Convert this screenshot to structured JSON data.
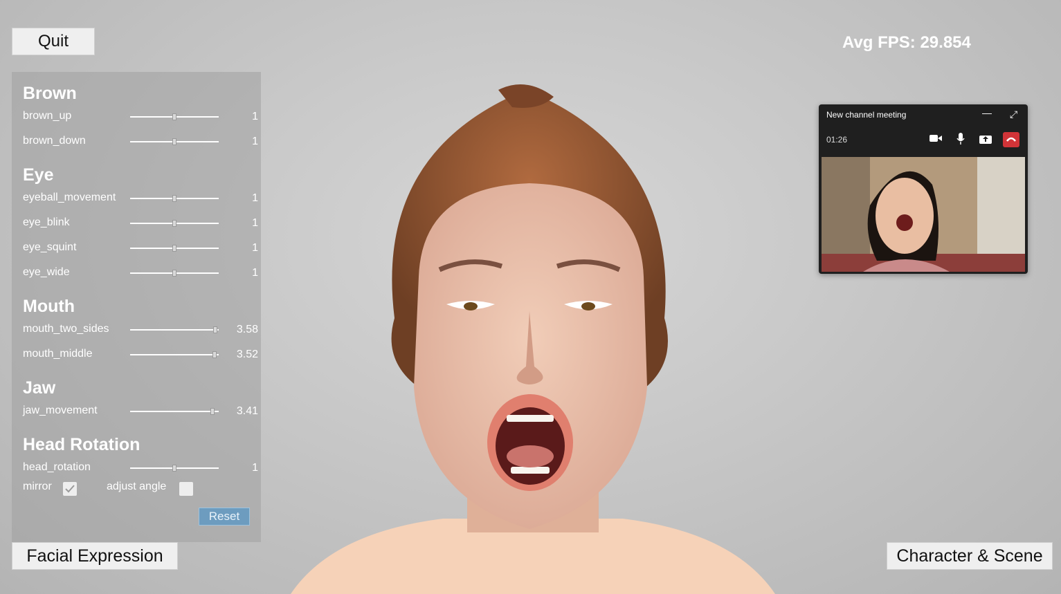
{
  "header": {
    "quit_label": "Quit",
    "fps_text": "Avg FPS: 29.854"
  },
  "panel": {
    "sections": [
      {
        "title": "Brown",
        "sliders": [
          {
            "label": "brown_up",
            "value": "1",
            "level": 0.5
          },
          {
            "label": "brown_down",
            "value": "1",
            "level": 0.5
          }
        ]
      },
      {
        "title": "Eye",
        "sliders": [
          {
            "label": "eyeball_movement",
            "value": "1",
            "level": 0.5
          },
          {
            "label": "eye_blink",
            "value": "1",
            "level": 0.5
          },
          {
            "label": "eye_squint",
            "value": "1",
            "level": 0.5
          },
          {
            "label": "eye_wide",
            "value": "1",
            "level": 0.5
          }
        ]
      },
      {
        "title": "Mouth",
        "sliders": [
          {
            "label": "mouth_two_sides",
            "value": "3.58",
            "level": 0.96
          },
          {
            "label": "mouth_middle",
            "value": "3.52",
            "level": 0.95
          }
        ]
      },
      {
        "title": "Jaw",
        "sliders": [
          {
            "label": "jaw_movement",
            "value": "3.41",
            "level": 0.93
          }
        ]
      },
      {
        "title": "Head Rotation",
        "sliders": [
          {
            "label": "head_rotation",
            "value": "1",
            "level": 0.5
          }
        ]
      }
    ],
    "mirror_label": "mirror",
    "mirror_checked": true,
    "adjust_angle_label": "adjust angle",
    "adjust_angle_checked": false,
    "reset_label": "Reset"
  },
  "footer": {
    "facial_expression_label": "Facial Expression",
    "character_scene_label": "Character & Scene"
  },
  "meeting": {
    "title": "New channel meeting",
    "timer": "01:26",
    "icons": [
      "minimize-icon",
      "expand-icon",
      "camera-icon",
      "microphone-icon",
      "share-icon",
      "hang-up-icon"
    ],
    "hangup_color": "#d13438"
  },
  "colors": {
    "accent": "#6d9cbf"
  }
}
